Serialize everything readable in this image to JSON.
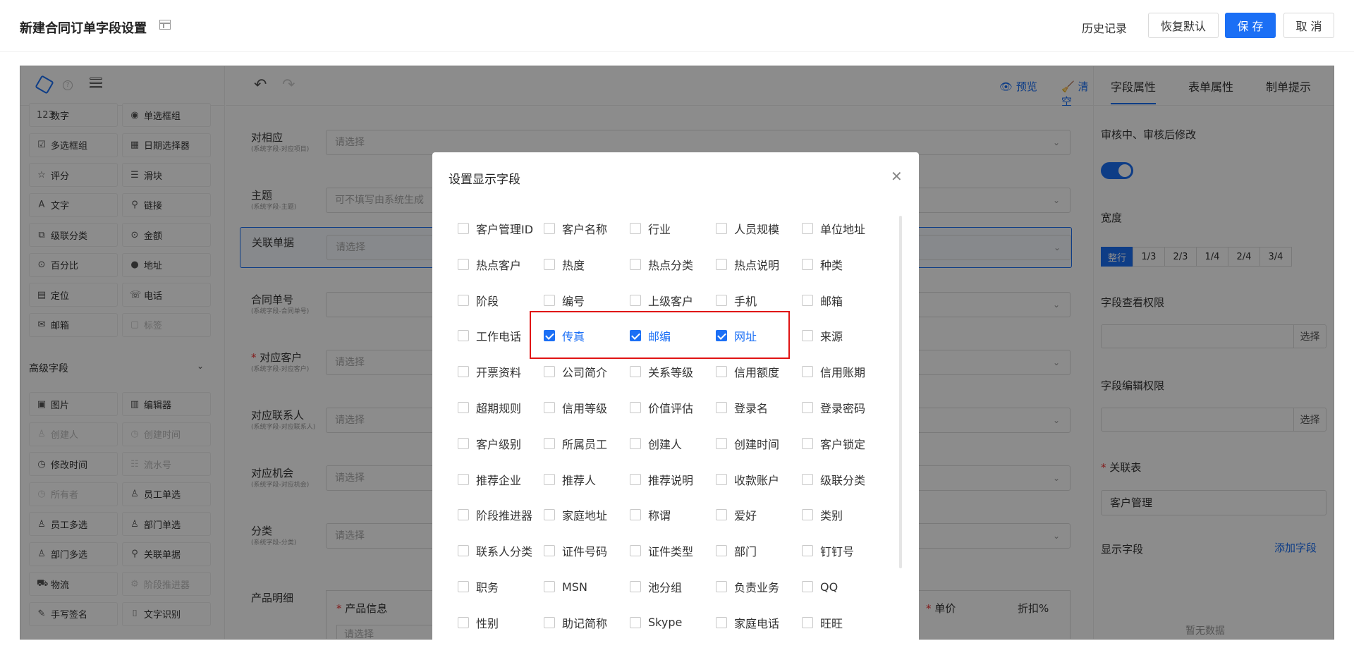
{
  "header": {
    "title": "新建合同订单字段设置",
    "history": "历史记录",
    "restore": "恢复默认",
    "save": "保 存",
    "cancel": "取 消"
  },
  "left": {
    "components": [
      {
        "icon": "123",
        "label": "数字",
        "disabled": false
      },
      {
        "icon": "◉",
        "label": "单选框组",
        "disabled": false
      },
      {
        "icon": "☑",
        "label": "多选框组",
        "disabled": false
      },
      {
        "icon": "▦",
        "label": "日期选择器",
        "disabled": false
      },
      {
        "icon": "☆",
        "label": "评分",
        "disabled": false
      },
      {
        "icon": "☰",
        "label": "滑块",
        "disabled": false
      },
      {
        "icon": "A",
        "label": "文字",
        "disabled": false
      },
      {
        "icon": "⚲",
        "label": "链接",
        "disabled": false
      },
      {
        "icon": "⧉",
        "label": "级联分类",
        "disabled": false
      },
      {
        "icon": "⊙",
        "label": "金额",
        "disabled": false
      },
      {
        "icon": "⊙",
        "label": "百分比",
        "disabled": false
      },
      {
        "icon": "●",
        "label": "地址",
        "disabled": false
      },
      {
        "icon": "▤",
        "label": "定位",
        "disabled": false
      },
      {
        "icon": "☏",
        "label": "电话",
        "disabled": false
      },
      {
        "icon": "✉",
        "label": "邮箱",
        "disabled": false
      },
      {
        "icon": "▢",
        "label": "标签",
        "disabled": true
      }
    ],
    "advanced_title": "高级字段",
    "advanced": [
      {
        "icon": "▣",
        "label": "图片",
        "disabled": false
      },
      {
        "icon": "▥",
        "label": "编辑器",
        "disabled": false
      },
      {
        "icon": "♙",
        "label": "创建人",
        "disabled": true
      },
      {
        "icon": "◷",
        "label": "创建时间",
        "disabled": true
      },
      {
        "icon": "◷",
        "label": "修改时间",
        "disabled": false
      },
      {
        "icon": "☷",
        "label": "流水号",
        "disabled": true
      },
      {
        "icon": "◷",
        "label": "所有者",
        "disabled": true
      },
      {
        "icon": "♙",
        "label": "员工单选",
        "disabled": false
      },
      {
        "icon": "♙",
        "label": "员工多选",
        "disabled": false
      },
      {
        "icon": "♙",
        "label": "部门单选",
        "disabled": false
      },
      {
        "icon": "♙",
        "label": "部门多选",
        "disabled": false
      },
      {
        "icon": "⚲",
        "label": "关联单据",
        "disabled": false
      },
      {
        "icon": "⛟",
        "label": "物流",
        "disabled": false
      },
      {
        "icon": "⚙",
        "label": "阶段推进器",
        "disabled": true
      },
      {
        "icon": "✎",
        "label": "手写签名",
        "disabled": false
      },
      {
        "icon": "⌷",
        "label": "文字识别",
        "disabled": false
      }
    ]
  },
  "center": {
    "preview": "预览",
    "clear": "清空",
    "rows": [
      {
        "label": "对相应",
        "sub": "(系统字段-对应项目)",
        "placeholder": "请选择",
        "required": false
      },
      {
        "label": "主题",
        "sub": "(系统字段-主题)",
        "placeholder": "可不填写由系统生成",
        "required": false
      },
      {
        "label": "关联单据",
        "sub": "",
        "placeholder": "请选择",
        "required": false
      },
      {
        "label": "合同单号",
        "sub": "(系统字段-合同单号)",
        "placeholder": "",
        "required": false
      },
      {
        "label": "对应客户",
        "sub": "(系统字段-对应客户)",
        "placeholder": "请选择",
        "required": true
      },
      {
        "label": "对应联系人",
        "sub": "(系统字段-对应联系人)",
        "placeholder": "请选择",
        "required": false
      },
      {
        "label": "对应机会",
        "sub": "(系统字段-对应机会)",
        "placeholder": "请选择",
        "required": false
      },
      {
        "label": "分类",
        "sub": "(系统字段-分类)",
        "placeholder": "请选择",
        "required": false
      }
    ],
    "product_label": "产品明细",
    "product_info": "产品信息",
    "product_select": "请选择",
    "unit_price": "单价",
    "discount": "折扣%"
  },
  "right": {
    "tabs": [
      "字段属性",
      "表单属性",
      "制单提示"
    ],
    "edit_label": "审核中、审核后修改",
    "width_label": "宽度",
    "widths": [
      "整行",
      "1/3",
      "2/3",
      "1/4",
      "2/4",
      "3/4"
    ],
    "view_perm": "字段查看权限",
    "edit_perm": "字段编辑权限",
    "select": "选择",
    "related_table": "关联表",
    "related_value": "客户管理",
    "display_fields": "显示字段",
    "add_field": "添加字段",
    "empty": "暂无数据"
  },
  "modal": {
    "title": "设置显示字段",
    "fields": [
      {
        "label": "客户管理ID",
        "checked": false
      },
      {
        "label": "客户名称",
        "checked": false
      },
      {
        "label": "行业",
        "checked": false
      },
      {
        "label": "人员规模",
        "checked": false
      },
      {
        "label": "单位地址",
        "checked": false
      },
      {
        "label": "热点客户",
        "checked": false
      },
      {
        "label": "热度",
        "checked": false
      },
      {
        "label": "热点分类",
        "checked": false
      },
      {
        "label": "热点说明",
        "checked": false
      },
      {
        "label": "种类",
        "checked": false
      },
      {
        "label": "阶段",
        "checked": false
      },
      {
        "label": "编号",
        "checked": false
      },
      {
        "label": "上级客户",
        "checked": false
      },
      {
        "label": "手机",
        "checked": false
      },
      {
        "label": "邮箱",
        "checked": false
      },
      {
        "label": "工作电话",
        "checked": false
      },
      {
        "label": "传真",
        "checked": true
      },
      {
        "label": "邮编",
        "checked": true
      },
      {
        "label": "网址",
        "checked": true
      },
      {
        "label": "来源",
        "checked": false
      },
      {
        "label": "开票资料",
        "checked": false
      },
      {
        "label": "公司简介",
        "checked": false
      },
      {
        "label": "关系等级",
        "checked": false
      },
      {
        "label": "信用额度",
        "checked": false
      },
      {
        "label": "信用账期",
        "checked": false
      },
      {
        "label": "超期规则",
        "checked": false
      },
      {
        "label": "信用等级",
        "checked": false
      },
      {
        "label": "价值评估",
        "checked": false
      },
      {
        "label": "登录名",
        "checked": false
      },
      {
        "label": "登录密码",
        "checked": false
      },
      {
        "label": "客户级别",
        "checked": false
      },
      {
        "label": "所属员工",
        "checked": false
      },
      {
        "label": "创建人",
        "checked": false
      },
      {
        "label": "创建时间",
        "checked": false
      },
      {
        "label": "客户锁定",
        "checked": false
      },
      {
        "label": "推荐企业",
        "checked": false
      },
      {
        "label": "推荐人",
        "checked": false
      },
      {
        "label": "推荐说明",
        "checked": false
      },
      {
        "label": "收款账户",
        "checked": false
      },
      {
        "label": "级联分类",
        "checked": false
      },
      {
        "label": "阶段推进器",
        "checked": false
      },
      {
        "label": "家庭地址",
        "checked": false
      },
      {
        "label": "称谓",
        "checked": false
      },
      {
        "label": "爱好",
        "checked": false
      },
      {
        "label": "类别",
        "checked": false
      },
      {
        "label": "联系人分类",
        "checked": false
      },
      {
        "label": "证件号码",
        "checked": false
      },
      {
        "label": "证件类型",
        "checked": false
      },
      {
        "label": "部门",
        "checked": false
      },
      {
        "label": "钉钉号",
        "checked": false
      },
      {
        "label": "职务",
        "checked": false
      },
      {
        "label": "MSN",
        "checked": false
      },
      {
        "label": "池分组",
        "checked": false
      },
      {
        "label": "负责业务",
        "checked": false
      },
      {
        "label": "QQ",
        "checked": false
      },
      {
        "label": "性别",
        "checked": false
      },
      {
        "label": "助记简称",
        "checked": false
      },
      {
        "label": "Skype",
        "checked": false
      },
      {
        "label": "家庭电话",
        "checked": false
      },
      {
        "label": "旺旺",
        "checked": false
      }
    ]
  }
}
